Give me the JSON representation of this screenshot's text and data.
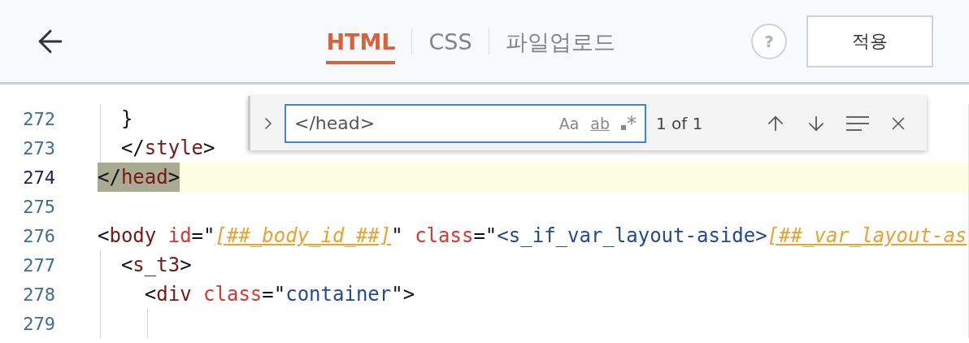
{
  "header": {
    "tabs": [
      {
        "label": "HTML",
        "selected": true
      },
      {
        "label": "CSS",
        "selected": false
      },
      {
        "label": "파일업로드",
        "selected": false
      }
    ],
    "help": "?",
    "apply_button": "적용"
  },
  "editor": {
    "lines": [
      {
        "number": "272",
        "current": false,
        "match": false,
        "tokens": [
          {
            "kind": "punct",
            "text": "  }"
          }
        ]
      },
      {
        "number": "273",
        "current": false,
        "match": false,
        "tokens": [
          {
            "kind": "punct",
            "text": "  </"
          },
          {
            "kind": "tag",
            "text": "style"
          },
          {
            "kind": "punct",
            "text": ">"
          }
        ]
      },
      {
        "number": "274",
        "current": true,
        "match": true,
        "tokens": [
          {
            "kind": "punct",
            "text": "</"
          },
          {
            "kind": "tag",
            "text": "head"
          },
          {
            "kind": "punct",
            "text": ">"
          }
        ]
      },
      {
        "number": "275",
        "current": false
      },
      {
        "number": "276",
        "current": false,
        "match": false,
        "tokens": [
          {
            "kind": "punct",
            "text": "<"
          },
          {
            "kind": "tag",
            "text": "body"
          },
          {
            "kind": "attr",
            "text": " id"
          },
          {
            "kind": "punct",
            "text": "=\""
          },
          {
            "kind": "template",
            "text": "[##_body_id_##]"
          },
          {
            "kind": "punct",
            "text": "\""
          },
          {
            "kind": "attr",
            "text": " class"
          },
          {
            "kind": "punct",
            "text": "=\""
          },
          {
            "kind": "string",
            "text": "<s_if_var_layout-aside>"
          },
          {
            "kind": "template",
            "text": "[##_var_layout-as"
          }
        ]
      },
      {
        "number": "277",
        "current": false,
        "match": false,
        "tokens": [
          {
            "kind": "punct",
            "text": "  <"
          },
          {
            "kind": "tag",
            "text": "s_t3"
          },
          {
            "kind": "punct",
            "text": ">"
          }
        ]
      },
      {
        "number": "278",
        "current": false,
        "match": false,
        "tokens": [
          {
            "kind": "punct",
            "text": "    <"
          },
          {
            "kind": "tag",
            "text": "div"
          },
          {
            "kind": "attr",
            "text": " class"
          },
          {
            "kind": "punct",
            "text": "=\""
          },
          {
            "kind": "string",
            "text": "container"
          },
          {
            "kind": "punct",
            "text": "\">"
          }
        ]
      },
      {
        "number": "279",
        "current": false
      }
    ]
  },
  "find": {
    "expanded": false,
    "query": "</head>",
    "options": [
      {
        "kind": "case",
        "text": "Aa"
      },
      {
        "kind": "word",
        "text": "ab"
      },
      {
        "kind": "regex",
        "text": "*"
      }
    ],
    "count": "1 of 1"
  }
}
